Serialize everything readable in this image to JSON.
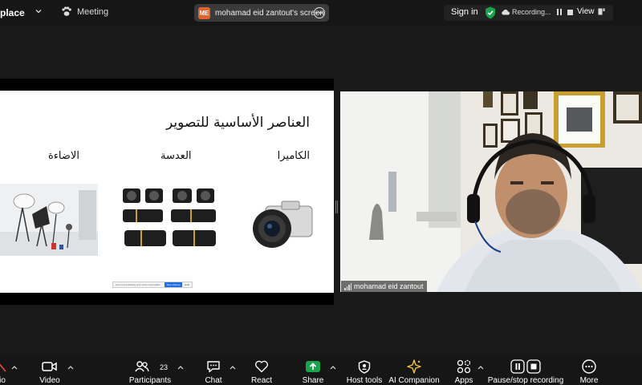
{
  "topbar": {
    "app_label": "place",
    "meeting_label": "Meeting",
    "share_badge": "ME",
    "share_label": "mohamad eid zantout's screen",
    "signin_label": "Sign in",
    "recording_label": "Recording...",
    "view_label": "View"
  },
  "slide": {
    "title": "العناصر الأساسية للتصوير",
    "columns": [
      "الكاميرا",
      "العدسة",
      "الاضاءة"
    ],
    "notification_text": "zoom.us is sharing your screen and audio",
    "stop_label": "Stop sharing",
    "hide_label": "Hide"
  },
  "video": {
    "participant_name": "mohamad eid zantout"
  },
  "toolbar": {
    "audio_label": "io",
    "video_label": "Video",
    "participants_label": "Participants",
    "participants_count": "23",
    "chat_label": "Chat",
    "react_label": "React",
    "share_label": "Share",
    "hosttools_label": "Host tools",
    "ai_label": "AI Companion",
    "apps_label": "Apps",
    "record_label": "Pause/stop recording",
    "more_label": "More"
  },
  "colors": {
    "share_green": "#19a34a",
    "badge_orange": "#e0622d",
    "accent_blue": "#1d6ce0",
    "ai_yellow": "#f0c040"
  },
  "icons": [
    "chevron-down-icon",
    "paw-icon",
    "more-icon",
    "shield-check-icon",
    "cloud-icon",
    "pause-icon",
    "stop-icon",
    "view-icon",
    "mic-muted-icon",
    "video-icon",
    "participants-icon",
    "chat-icon",
    "react-icon",
    "share-arrow-icon",
    "host-tools-icon",
    "ai-sparkle-icon",
    "apps-icon",
    "pause-stop-icon",
    "more-dots-icon"
  ]
}
